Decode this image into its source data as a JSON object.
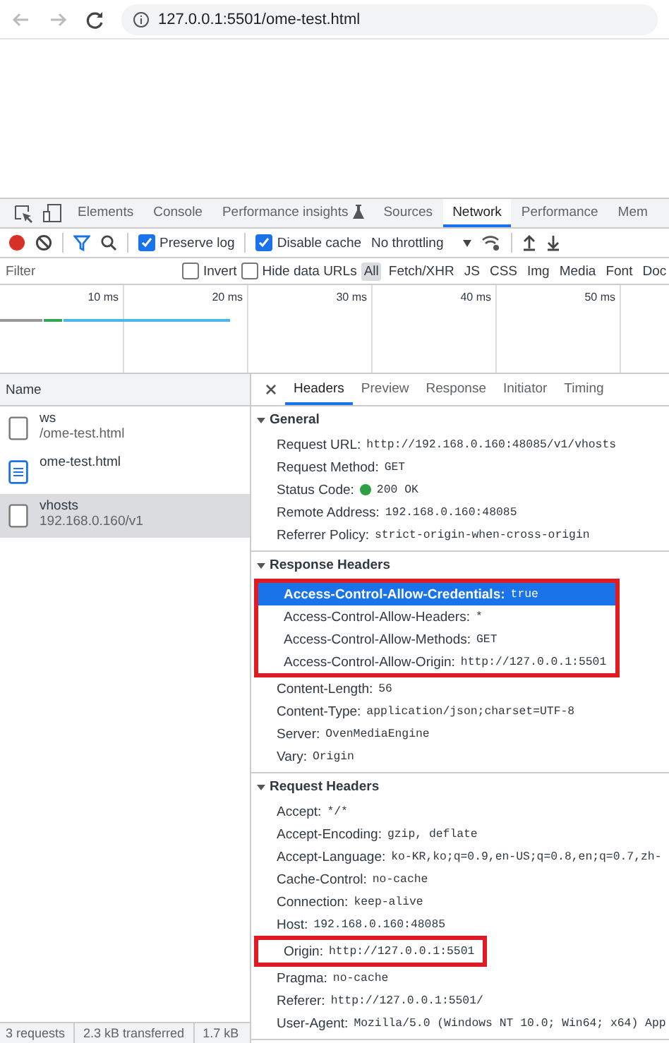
{
  "browser": {
    "url": "127.0.0.1:5501/ome-test.html"
  },
  "devtools_tabs": [
    {
      "label": "Elements",
      "selected": false
    },
    {
      "label": "Console",
      "selected": false
    },
    {
      "label": "Performance insights",
      "selected": false,
      "flask": true
    },
    {
      "label": "Sources",
      "selected": false
    },
    {
      "label": "Network",
      "selected": true
    },
    {
      "label": "Performance",
      "selected": false
    },
    {
      "label": "Mem",
      "selected": false
    }
  ],
  "toolbar": {
    "preserve_log": {
      "label": "Preserve log",
      "checked": true
    },
    "disable_cache": {
      "label": "Disable cache",
      "checked": true
    },
    "throttling": "No throttling"
  },
  "filter": {
    "placeholder": "Filter",
    "invert": {
      "label": "Invert",
      "checked": false
    },
    "hide_data_urls": {
      "label": "Hide data URLs",
      "checked": false
    },
    "types": [
      {
        "label": "All",
        "selected": true
      },
      {
        "label": "Fetch/XHR",
        "selected": false
      },
      {
        "label": "JS",
        "selected": false
      },
      {
        "label": "CSS",
        "selected": false
      },
      {
        "label": "Img",
        "selected": false
      },
      {
        "label": "Media",
        "selected": false
      },
      {
        "label": "Font",
        "selected": false
      },
      {
        "label": "Doc",
        "selected": false
      }
    ]
  },
  "timeline": {
    "ticks": [
      "10 ms",
      "20 ms",
      "30 ms",
      "40 ms",
      "50 ms"
    ]
  },
  "requests": {
    "column": "Name",
    "rows": [
      {
        "name": "ws",
        "path": "/ome-test.html",
        "kind": "file",
        "selected": false
      },
      {
        "name": "ome-test.html",
        "kind": "document",
        "selected": false
      },
      {
        "name": "vhosts",
        "path": "192.168.0.160/v1",
        "kind": "file",
        "selected": true
      }
    ],
    "status_bar": [
      "3 requests",
      "2.3 kB transferred",
      "1.7 kB"
    ]
  },
  "detail_tabs": [
    {
      "label": "Headers",
      "selected": true
    },
    {
      "label": "Preview",
      "selected": false
    },
    {
      "label": "Response",
      "selected": false
    },
    {
      "label": "Initiator",
      "selected": false
    },
    {
      "label": "Timing",
      "selected": false
    }
  ],
  "sections": [
    {
      "title": "General",
      "expanded": true,
      "rows": [
        {
          "name": "Request URL:",
          "value": "http://192.168.0.160:48085/v1/vhosts",
          "highlighted": false
        },
        {
          "name": "Request Method:",
          "value": "GET",
          "highlighted": false
        },
        {
          "name": "Status Code:",
          "value": "200 OK",
          "color": "#2ea043",
          "highlighted": false
        },
        {
          "name": "Remote Address:",
          "value": "192.168.0.160:48085",
          "highlighted": false
        },
        {
          "name": "Referrer Policy:",
          "value": "strict-origin-when-cross-origin",
          "highlighted": false
        }
      ]
    },
    {
      "title": "Response Headers",
      "expanded": true,
      "rows": [
        {
          "name": "Access-Control-Allow-Credentials:",
          "value": "true",
          "selected": true,
          "highlighted": true
        },
        {
          "name": "Access-Control-Allow-Headers:",
          "value": "*",
          "selected": false,
          "highlighted": true
        },
        {
          "name": "Access-Control-Allow-Methods:",
          "value": "GET",
          "selected": false,
          "highlighted": true
        },
        {
          "name": "Access-Control-Allow-Origin:",
          "value": "http://127.0.0.1:5501",
          "selected": false,
          "highlighted": true
        },
        {
          "name": "Content-Length:",
          "value": "56",
          "selected": false,
          "highlighted": false
        },
        {
          "name": "Content-Type:",
          "value": "application/json;charset=UTF-8",
          "selected": false,
          "highlighted": false
        },
        {
          "name": "Server:",
          "value": "OvenMediaEngine",
          "selected": false,
          "highlighted": false
        },
        {
          "name": "Vary:",
          "value": "Origin",
          "selected": false,
          "highlighted": false
        }
      ]
    },
    {
      "title": "Request Headers",
      "expanded": true,
      "rows": [
        {
          "name": "Accept:",
          "value": "*/*",
          "highlighted": false
        },
        {
          "name": "Accept-Encoding:",
          "value": "gzip, deflate",
          "highlighted": false
        },
        {
          "name": "Accept-Language:",
          "value": "ko-KR,ko;q=0.9,en-US;q=0.8,en;q=0.7,zh-",
          "highlighted": false
        },
        {
          "name": "Cache-Control:",
          "value": "no-cache",
          "highlighted": false
        },
        {
          "name": "Connection:",
          "value": "keep-alive",
          "highlighted": false
        },
        {
          "name": "Host:",
          "value": "192.168.0.160:48085",
          "highlighted": false
        },
        {
          "name": "Origin:",
          "value": "http://127.0.0.1:5501",
          "highlighted": true
        },
        {
          "name": "Pragma:",
          "value": "no-cache",
          "highlighted": false
        },
        {
          "name": "Referer:",
          "value": "http://127.0.0.1:5501/",
          "highlighted": false
        },
        {
          "name": "User-Agent:",
          "value": "Mozilla/5.0 (Windows NT 10.0; Win64; x64) App",
          "highlighted": false
        }
      ]
    }
  ]
}
